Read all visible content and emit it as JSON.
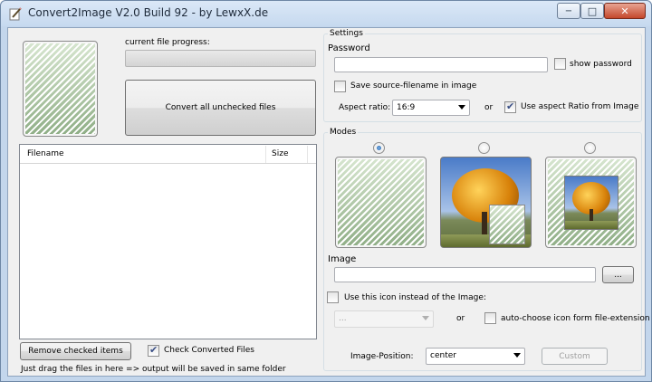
{
  "window": {
    "title": "Convert2Image V2.0 Build 92 - by LewxX.de",
    "min_glyph": "−",
    "max_glyph": "□",
    "close_glyph": "✕"
  },
  "left": {
    "progress_label": "current file progress:",
    "progress_value": 0,
    "convert_button": "Convert all unchecked files",
    "file_list": {
      "columns": [
        "Filename",
        "Size"
      ],
      "rows": []
    },
    "remove_button": "Remove checked items",
    "check_converted_label": "Check Converted Files",
    "check_converted_checked": true,
    "hint": "Just drag the files in here => output will be saved in same folder"
  },
  "settings": {
    "group_title": "Settings",
    "password_label": "Password",
    "password_value": "",
    "show_password_label": "show password",
    "show_password_checked": false,
    "save_filename_label": "Save source-filename in image",
    "save_filename_checked": false,
    "aspect_ratio_label": "Aspect ratio:",
    "aspect_ratio_value": "16:9",
    "or_label": "or",
    "use_aspect_label": "Use aspect Ratio from Image",
    "use_aspect_checked": true
  },
  "modes": {
    "group_title": "Modes",
    "selected_index": 0,
    "image_label": "Image",
    "image_value": "",
    "browse_button": "...",
    "use_icon_label": "Use this icon instead of the Image:",
    "use_icon_checked": false,
    "icon_combo_value": "...",
    "or_label": "or",
    "auto_icon_label": "auto-choose icon form file-extension",
    "auto_icon_checked": false,
    "position_label": "Image-Position:",
    "position_value": "center",
    "custom_button": "Custom"
  }
}
